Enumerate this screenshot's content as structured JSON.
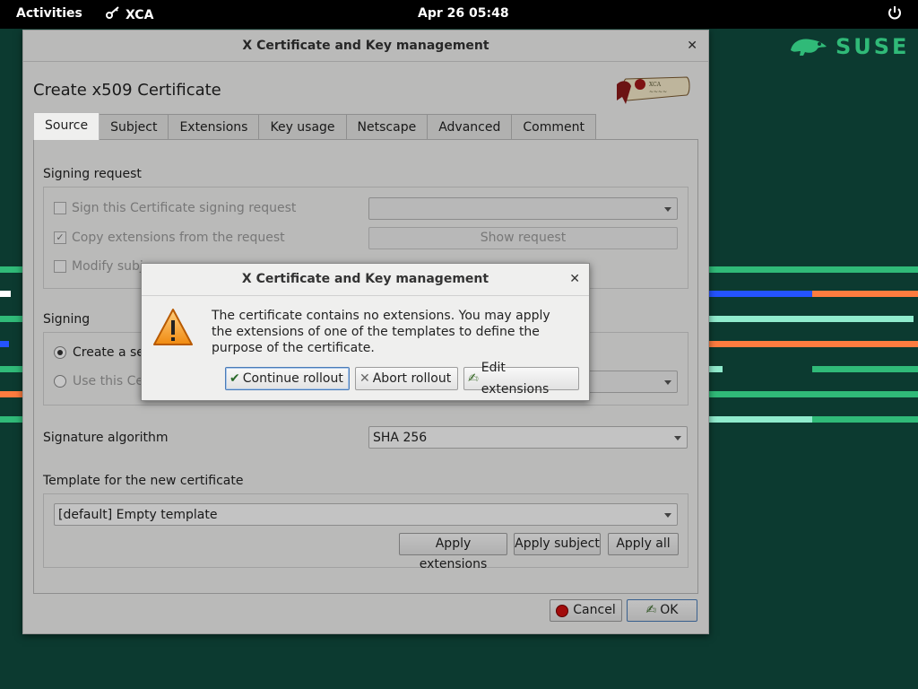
{
  "topbar": {
    "activities": "Activities",
    "app_name": "XCA",
    "clock": "Apr 26  05:48"
  },
  "desktop": {
    "brand": "SUSE",
    "colors": {
      "background": "#0c3a30",
      "green": "#30ba78",
      "orange": "#fe7c3f",
      "blue": "#2453ff",
      "mint": "#90ebcd"
    }
  },
  "window": {
    "title": "X Certificate and Key management",
    "heading": "Create x509 Certificate",
    "tabs": [
      "Source",
      "Subject",
      "Extensions",
      "Key usage",
      "Netscape",
      "Advanced",
      "Comment"
    ],
    "signing_request": {
      "title": "Signing request",
      "sign_csr": "Sign this Certificate signing request",
      "copy_ext": "Copy extensions from the request",
      "modify_subject": "Modify subj",
      "show_request": "Show request"
    },
    "signing": {
      "title": "Signing",
      "create_self": "Create a sel",
      "use_cert": "Use this Cer"
    },
    "sig_alg": {
      "label": "Signature algorithm",
      "value": "SHA 256"
    },
    "template": {
      "label": "Template for the new certificate",
      "value": "[default] Empty template",
      "apply_extensions": "Apply extensions",
      "apply_subject": "Apply subject",
      "apply_all": "Apply all"
    },
    "cancel": "Cancel",
    "ok": "OK"
  },
  "dialog": {
    "title": "X Certificate and Key management",
    "message": "The certificate contains no extensions. You may apply the extensions of one of the templates to define the purpose of the certificate.",
    "continue": "Continue rollout",
    "abort": "Abort rollout",
    "edit": "Edit extensions"
  }
}
